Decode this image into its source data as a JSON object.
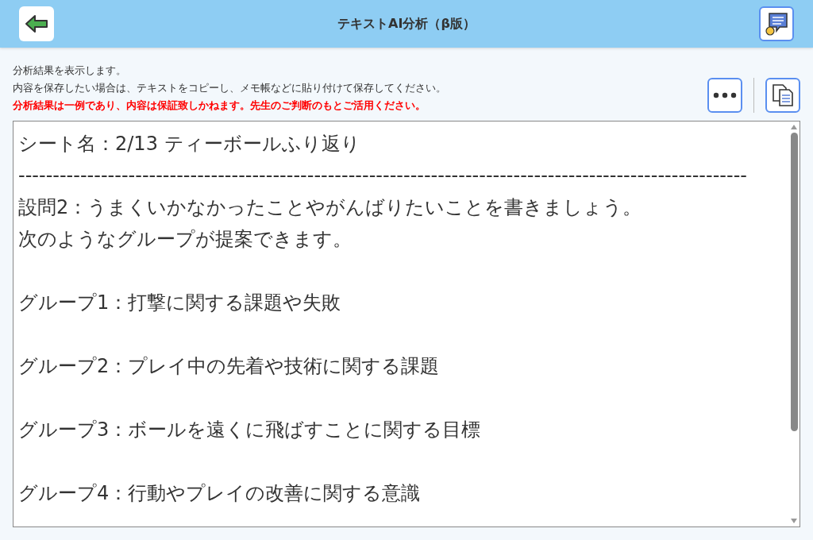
{
  "header": {
    "title": "テキストAI分析（β版）"
  },
  "notice": {
    "lines": [
      "分析結果を表示します。",
      "内容を保存したい場合は、テキストをコピーし、メモ帳などに貼り付けて保存してください。"
    ],
    "warning": "分析結果は一例であり、内容は保証致しかねます。先生のご判断のもとご活用ください。"
  },
  "result": {
    "blocks": [
      {
        "lines": [
          "シート名：2/13 ティーボールふり返り",
          "----------------------------------------------------------------------------------------------------------",
          "設問2：うまくいかなかったことやがんばりたいことを書きましょう。",
          "次のようなグループが提案できます。"
        ]
      },
      {
        "lines": [
          "グループ1：打撃に関する課題や失敗"
        ]
      },
      {
        "lines": [
          "グループ2：プレイ中の先着や技術に関する課題"
        ]
      },
      {
        "lines": [
          "グループ3：ボールを遠くに飛ばすことに関する目標"
        ]
      },
      {
        "lines": [
          "グループ4：行動やプレイの改善に関する意識"
        ]
      }
    ]
  }
}
